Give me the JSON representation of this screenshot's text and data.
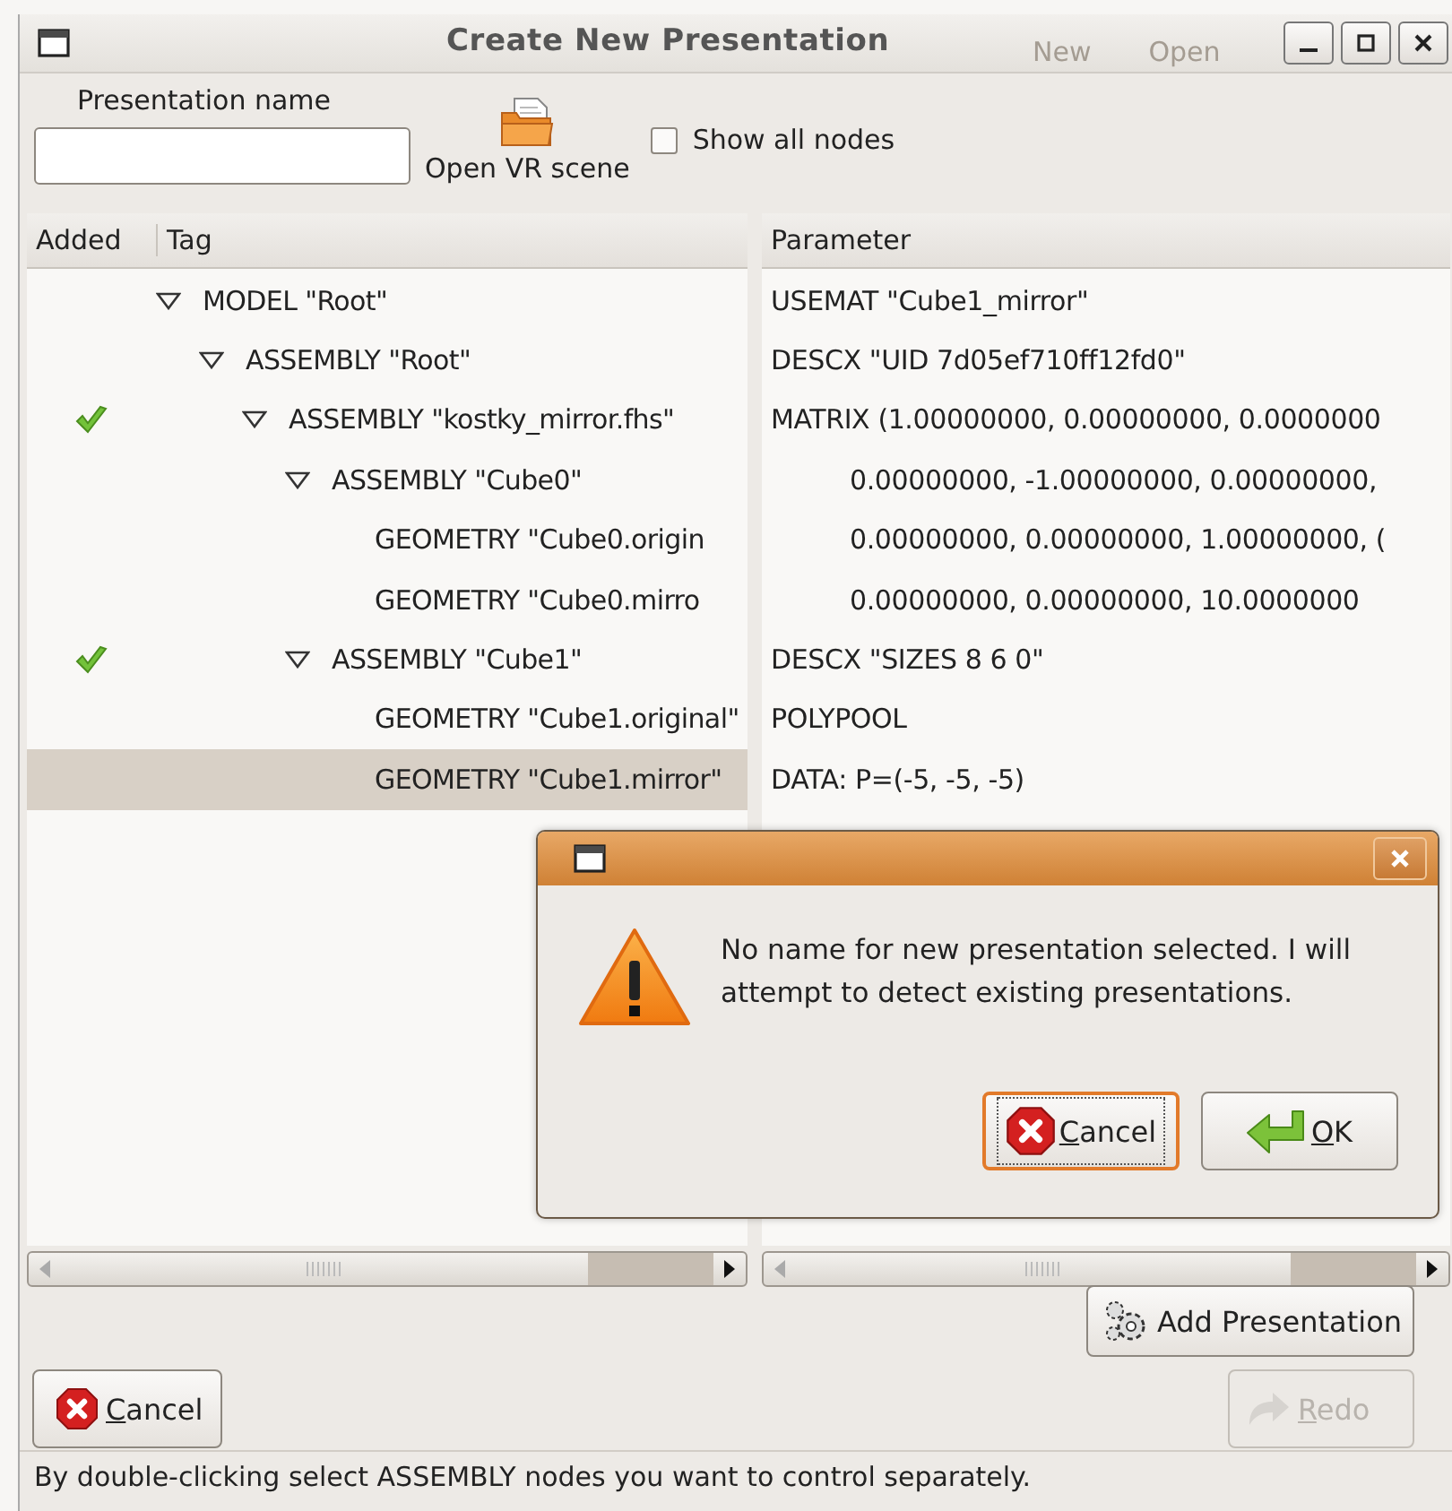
{
  "background_window": {
    "toolbar": [
      "New",
      "Open"
    ]
  },
  "window": {
    "title": "Create New Presentation"
  },
  "name_field": {
    "label": "Presentation name"
  },
  "open_scene_button": {
    "label": "Open VR scene"
  },
  "show_all_nodes": {
    "label": "Show all nodes",
    "checked": false
  },
  "tree": {
    "columns": [
      "Added",
      "Tag"
    ],
    "nodes": [
      {
        "tag": "MODEL \"Root\"",
        "added": false,
        "selected": false,
        "expanded": true,
        "children": [
          {
            "tag": "ASSEMBLY \"Root\"",
            "added": false,
            "selected": false,
            "expanded": true,
            "children": [
              {
                "tag": "ASSEMBLY \"kostky_mirror.fhs\"",
                "added": true,
                "selected": false,
                "expanded": true,
                "children": [
                  {
                    "tag": "ASSEMBLY \"Cube0\"",
                    "added": false,
                    "selected": false,
                    "expanded": true,
                    "children": [
                      {
                        "tag": "GEOMETRY \"Cube0.origin",
                        "added": false,
                        "selected": false
                      },
                      {
                        "tag": "GEOMETRY \"Cube0.mirro",
                        "added": false,
                        "selected": false
                      }
                    ]
                  },
                  {
                    "tag": "ASSEMBLY \"Cube1\"",
                    "added": true,
                    "selected": false,
                    "expanded": true,
                    "children": [
                      {
                        "tag": "GEOMETRY \"Cube1.original\"",
                        "added": false,
                        "selected": false
                      },
                      {
                        "tag": "GEOMETRY \"Cube1.mirror\"",
                        "added": false,
                        "selected": true
                      }
                    ]
                  }
                ]
              }
            ]
          }
        ]
      }
    ]
  },
  "parameters": {
    "column": "Parameter",
    "lines": [
      {
        "text": "USEMAT \"Cube1_mirror\""
      },
      {
        "text": "DESCX \"UID 7d05ef710ff12fd0\""
      },
      {
        "text": "MATRIX (1.00000000, 0.00000000, 0.0000000",
        "continued": [
          "0.00000000, -1.00000000, 0.00000000,",
          "0.00000000, 0.00000000, 1.00000000, (",
          "0.00000000, 0.00000000, 10.0000000"
        ]
      },
      {
        "text": "DESCX \"SIZES 8 6 0\""
      },
      {
        "text": "POLYPOOL"
      },
      {
        "text": "DATA: P=(-5, -5, -5)"
      }
    ]
  },
  "add_presentation_button": {
    "label": "Add Presentation"
  },
  "cancel_button": {
    "label": "Cancel"
  },
  "redo_button": {
    "label": "Redo",
    "disabled": true
  },
  "status_bar": "By double-clicking select ASSEMBLY nodes you want to control separately.",
  "dialog": {
    "message": "No name for new presentation selected. I will attempt to detect existing presentations.",
    "buttons": [
      {
        "kind": "cancel",
        "label": "Cancel",
        "focused": true
      },
      {
        "kind": "ok",
        "label": "OK",
        "focused": false
      }
    ]
  }
}
